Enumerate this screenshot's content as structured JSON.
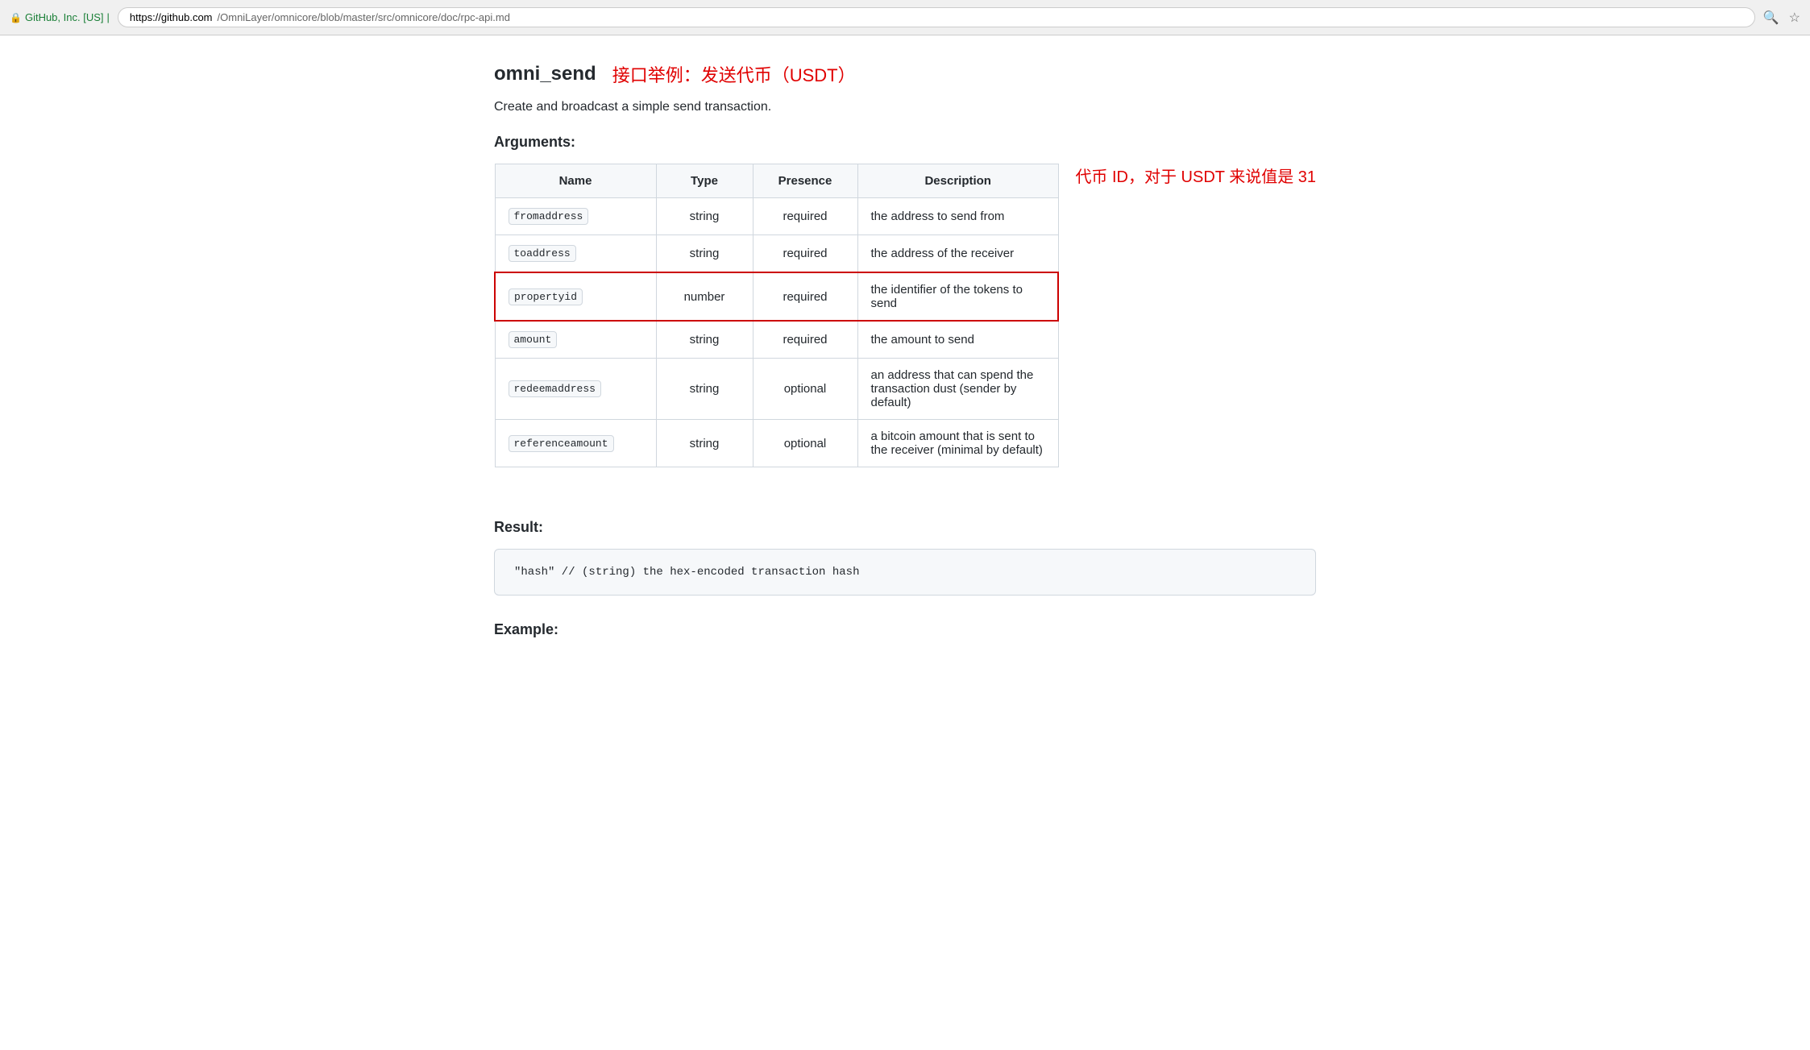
{
  "browser": {
    "security_label": "GitHub, Inc. [US]",
    "url_domain": "https://github.com",
    "url_path": "/OmniLayer/omnicore/blob/master/src/omnicore/doc/rpc-api.md",
    "search_icon": "🔍",
    "star_icon": "☆"
  },
  "page": {
    "title": "omni_send",
    "subtitle": "接口举例：发送代币（USDT）",
    "description": "Create and broadcast a simple send transaction.",
    "arguments_heading": "Arguments:",
    "result_heading": "Result:",
    "example_heading": "Example:"
  },
  "table": {
    "headers": [
      "Name",
      "Type",
      "Presence",
      "Description"
    ],
    "rows": [
      {
        "name": "fromaddress",
        "type": "string",
        "presence": "required",
        "description": "the address to send from",
        "highlighted": false
      },
      {
        "name": "toaddress",
        "type": "string",
        "presence": "required",
        "description": "the address of the receiver",
        "highlighted": false
      },
      {
        "name": "propertyid",
        "type": "number",
        "presence": "required",
        "description": "the identifier of the tokens to send",
        "highlighted": true,
        "annotation": "代币 ID，对于 USDT 来说值是 31"
      },
      {
        "name": "amount",
        "type": "string",
        "presence": "required",
        "description": "the amount to send",
        "highlighted": false
      },
      {
        "name": "redeemaddress",
        "type": "string",
        "presence": "optional",
        "description": "an address that can spend the transaction dust (sender by default)",
        "highlighted": false
      },
      {
        "name": "referenceamount",
        "type": "string",
        "presence": "optional",
        "description": "a bitcoin amount that is sent to the receiver (minimal by default)",
        "highlighted": false
      }
    ]
  },
  "result": {
    "code": "\"hash\"  // (string) the hex-encoded transaction hash"
  }
}
